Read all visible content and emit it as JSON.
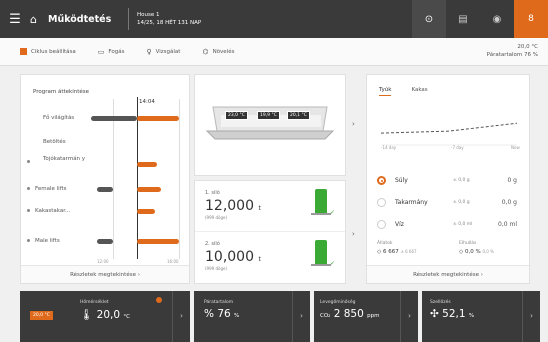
{
  "topbar": {
    "title": "Működtetés",
    "house_name": "House 1",
    "house_info": "14/25, 18 HÉT 131 NAP",
    "alert_badge": "8"
  },
  "subbar": {
    "tabs": [
      {
        "label": "Ciklus beállítása"
      },
      {
        "label": "Fogás"
      },
      {
        "label": "Vizsgálat"
      },
      {
        "label": "Növelés"
      }
    ],
    "outside_temp": "20,0 °C",
    "humidity": "Páratartalom 76 %"
  },
  "program": {
    "title": "Program áttekintése",
    "now_label": "14:04",
    "rows": [
      {
        "label": "Fő világítás"
      },
      {
        "label": "Betöltés"
      },
      {
        "label": "Tojókatarmán y"
      },
      {
        "label": "Female lifts"
      },
      {
        "label": "Kakastakar..."
      },
      {
        "label": "Male lifts"
      }
    ],
    "axis_left": "12:00",
    "axis_right": "16:00",
    "details_link": "Részletek megtekintése"
  },
  "feeder": {
    "temps": [
      "23,0 °C",
      "19,9 °C",
      "20,1 °C"
    ]
  },
  "silos": [
    {
      "name": "1. siló",
      "value": "12,000",
      "unit": "t",
      "days": "(999 döge)"
    },
    {
      "name": "2. siló",
      "value": "10,000",
      "unit": "t",
      "days": "(999 döge)"
    }
  ],
  "consumption": {
    "tabs": [
      "Tyúk",
      "Kakas"
    ],
    "chart_labels": [
      "-14 day",
      "-7 day",
      "Now"
    ],
    "chart_data": {
      "type": "line",
      "x": [
        "-14 day",
        "-7 day",
        "Now"
      ],
      "series": [
        {
          "values": [
            0.3,
            0.35,
            0.55
          ]
        }
      ]
    },
    "feeds": [
      {
        "name": "Súly",
        "mid": "± 0,0 g",
        "value": "0 g"
      },
      {
        "name": "Takarmány",
        "mid": "± 0,0 g",
        "value": "0,0 g"
      },
      {
        "name": "Víz",
        "mid": "± 0,0 ml",
        "value": "0,0 ml"
      }
    ],
    "alive_label": "Állatok",
    "alive_value": "6 667",
    "alive_sub": "± 6 667",
    "dead_label": "Elhullás",
    "dead_value": "0,0 %",
    "dead_sub": "0,0 %",
    "details_link": "Részletek megtekintése"
  },
  "stats": [
    {
      "label": "Hőmérséklet",
      "value": "20,0",
      "unit": "°C",
      "pill": "20,0 °C"
    },
    {
      "label": "Páratartalom",
      "value": "76",
      "unit": "%"
    },
    {
      "label": "Levegőminőség",
      "value": "2 850",
      "unit": "ppm",
      "prefix": "CO₂"
    },
    {
      "label": "Szellőzés",
      "value": "52,1",
      "unit": "%"
    }
  ]
}
